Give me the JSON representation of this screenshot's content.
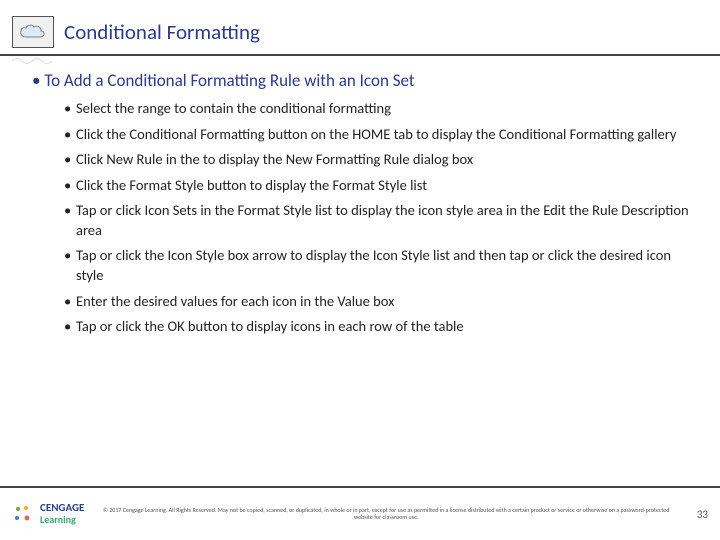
{
  "header": {
    "title": "Conditional Formatting",
    "icon_name": "cloud"
  },
  "content": {
    "heading": "To Add a Conditional Formatting Rule with an Icon Set",
    "steps": [
      "Select the range to contain the conditional formatting",
      "Click the Conditional Formatting button on the HOME tab to display the Conditional Formatting gallery",
      "Click New Rule in the to display the New Formatting Rule dialog box",
      "Click the Format Style button to display the Format Style list",
      "Tap or click Icon Sets in the Format Style list to display the icon style area in the Edit the Rule Description area",
      "Tap or click the Icon Style box arrow to display the Icon Style list and then tap or click the desired icon style",
      "Enter the desired values for each icon in the Value box",
      "Tap or click the OK button to display icons in each row of the table"
    ]
  },
  "footer": {
    "logo_top": "CENGAGE",
    "logo_bottom": "Learning",
    "copyright": "© 2017 Cengage Learning. All Rights Reserved. May not be copied, scanned, or duplicated, in whole or in part, except for use as permitted in a license distributed with a certain product or service or otherwise on a password-protected website for classroom use.",
    "page_number": "33"
  }
}
